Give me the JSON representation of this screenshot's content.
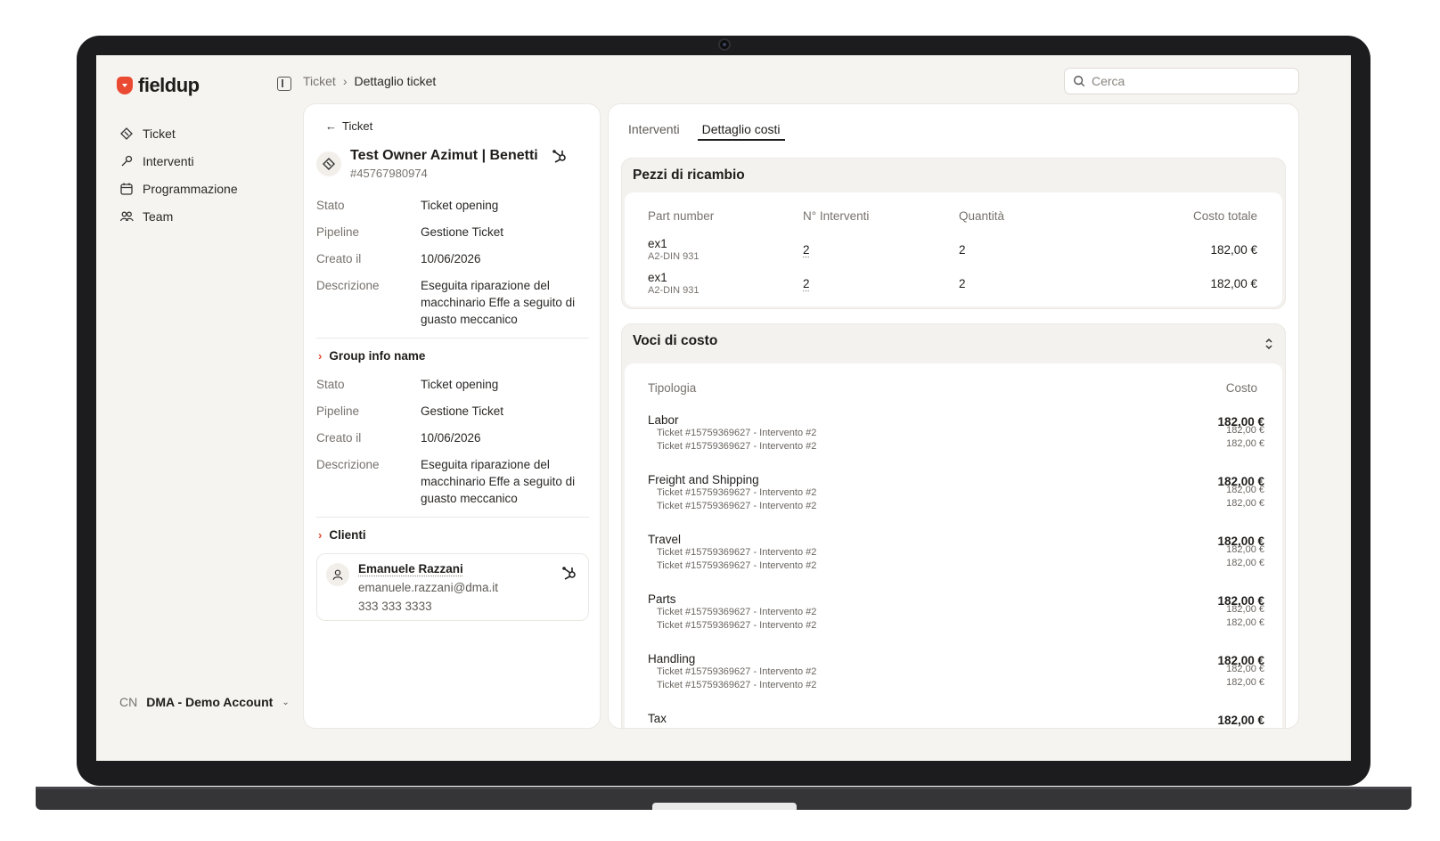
{
  "brand": {
    "name": "fieldup",
    "accent": "#ea4a31"
  },
  "sidebar": {
    "items": [
      {
        "label": "Ticket",
        "icon": "ticket-icon"
      },
      {
        "label": "Interventi",
        "icon": "wrench-icon"
      },
      {
        "label": "Programmazione",
        "icon": "calendar-icon"
      },
      {
        "label": "Team",
        "icon": "team-icon"
      }
    ],
    "account": {
      "initials": "CN",
      "name": "DMA - Demo Account"
    }
  },
  "breadcrumb": {
    "parent": "Ticket",
    "current": "Dettaglio ticket"
  },
  "search": {
    "placeholder": "Cerca"
  },
  "ticket": {
    "back_label": "Ticket",
    "title": "Test Owner Azimut | Benetti",
    "id": "#45767980974",
    "fields": [
      {
        "label": "Stato",
        "value": "Ticket opening"
      },
      {
        "label": "Pipeline",
        "value": "Gestione Ticket"
      },
      {
        "label": "Creato il",
        "value": "10/06/2026"
      },
      {
        "label": "Descrizione",
        "value": "Eseguita riparazione del macchinario Effe a seguito di guasto meccanico"
      }
    ],
    "group_title": "Group info name",
    "group_fields": [
      {
        "label": "Stato",
        "value": "Ticket opening"
      },
      {
        "label": "Pipeline",
        "value": "Gestione Ticket"
      },
      {
        "label": "Creato il",
        "value": "10/06/2026"
      },
      {
        "label": "Descrizione",
        "value": "Eseguita riparazione del macchinario Effe a seguito di guasto meccanico"
      }
    ],
    "clients_title": "Clienti",
    "client": {
      "name": "Emanuele Razzani",
      "email": "emanuele.razzani@dma.it",
      "phone": "333 333 3333"
    }
  },
  "tabs": [
    {
      "label": "Interventi",
      "active": false
    },
    {
      "label": "Dettaglio costi",
      "active": true
    }
  ],
  "parts": {
    "title": "Pezzi di ricambio",
    "columns": [
      "Part number",
      "N° Interventi",
      "Quantità",
      "Costo totale"
    ],
    "rows": [
      {
        "name": "ex1",
        "code": "A2-DIN 931",
        "interventions": "2",
        "quantity": "2",
        "total": "182,00 €"
      },
      {
        "name": "ex1",
        "code": "A2-DIN 931",
        "interventions": "2",
        "quantity": "2",
        "total": "182,00 €"
      }
    ]
  },
  "costs": {
    "title": "Voci di costo",
    "columns": [
      "Tipologia",
      "Costo"
    ],
    "groups": [
      {
        "name": "Labor",
        "total": "182,00 €",
        "lines": [
          {
            "label": "Ticket #15759369627 - Intervento #2",
            "value": "182,00 €"
          },
          {
            "label": "Ticket #15759369627 - Intervento #2",
            "value": "182,00 €"
          }
        ]
      },
      {
        "name": "Freight and Shipping",
        "total": "182,00 €",
        "lines": [
          {
            "label": "Ticket #15759369627 - Intervento #2",
            "value": "182,00 €"
          },
          {
            "label": "Ticket #15759369627 - Intervento #2",
            "value": "182,00 €"
          }
        ]
      },
      {
        "name": "Travel",
        "total": "182,00 €",
        "lines": [
          {
            "label": "Ticket #15759369627 - Intervento #2",
            "value": "182,00 €"
          },
          {
            "label": "Ticket #15759369627 - Intervento #2",
            "value": "182,00 €"
          }
        ]
      },
      {
        "name": "Parts",
        "total": "182,00 €",
        "lines": [
          {
            "label": "Ticket #15759369627 - Intervento #2",
            "value": "182,00 €"
          },
          {
            "label": "Ticket #15759369627 - Intervento #2",
            "value": "182,00 €"
          }
        ]
      },
      {
        "name": "Handling",
        "total": "182,00 €",
        "lines": [
          {
            "label": "Ticket #15759369627 - Intervento #2",
            "value": "182,00 €"
          },
          {
            "label": "Ticket #15759369627 - Intervento #2",
            "value": "182,00 €"
          }
        ]
      },
      {
        "name": "Tax",
        "total": "182,00 €",
        "lines": []
      }
    ]
  }
}
